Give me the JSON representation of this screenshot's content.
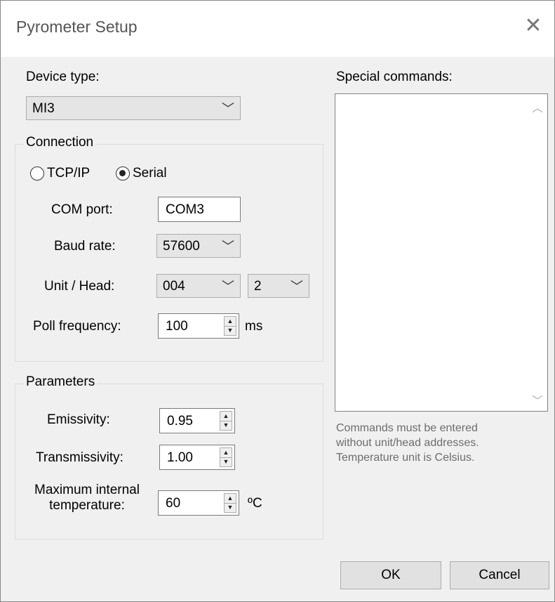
{
  "window": {
    "title": "Pyrometer Setup",
    "close_glyph": "✕"
  },
  "device_type": {
    "label": "Device type:",
    "selected": "MI3"
  },
  "connection": {
    "legend": "Connection",
    "radio_tcp_label": "TCP/IP",
    "radio_serial_label": "Serial",
    "selected_mode": "Serial",
    "com_port_label": "COM port:",
    "com_port_value": "COM3",
    "baud_rate_label": "Baud rate:",
    "baud_rate_value": "57600",
    "unit_head_label": "Unit / Head:",
    "unit_value": "004",
    "head_value": "2",
    "poll_frequency_label": "Poll frequency:",
    "poll_frequency_value": "100",
    "poll_frequency_unit": "ms"
  },
  "parameters": {
    "legend": "Parameters",
    "emissivity_label": "Emissivity:",
    "emissivity_value": "0.95",
    "transmissivity_label": "Transmissivity:",
    "transmissivity_value": "1.00",
    "max_temp_label_line1": "Maximum internal",
    "max_temp_label_line2": "temperature:",
    "max_temp_value": "60",
    "max_temp_unit": "ºC"
  },
  "special_commands": {
    "label": "Special commands:",
    "value": "",
    "hint_line1": "Commands must be entered",
    "hint_line2": "without unit/head addresses.",
    "hint_line3": "Temperature unit is Celsius."
  },
  "buttons": {
    "ok_label": "OK",
    "cancel_label": "Cancel"
  },
  "icons": {
    "dropdown": "chevron-down-icon",
    "spin": "spin-arrows-icon"
  }
}
